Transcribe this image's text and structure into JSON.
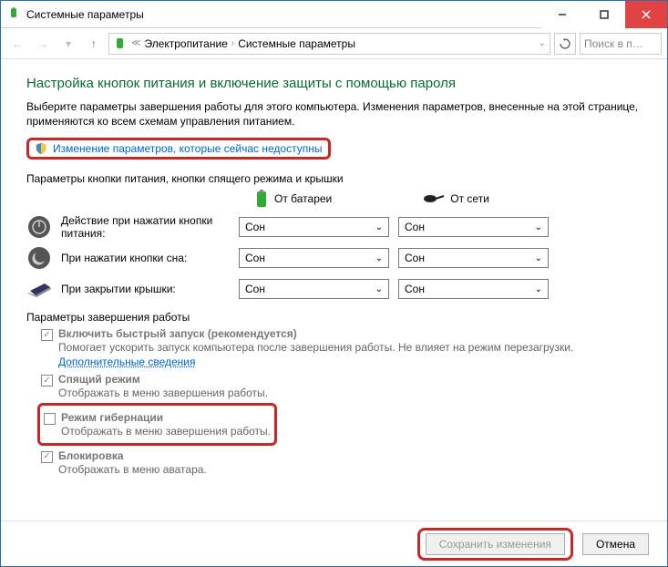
{
  "window": {
    "title": "Системные параметры"
  },
  "breadcrumb": {
    "p1": "Электропитание",
    "p2": "Системные параметры"
  },
  "search": {
    "placeholder": "Поиск в п…"
  },
  "heading": "Настройка кнопок питания и включение защиты с помощью пароля",
  "desc": "Выберите параметры завершения работы для этого компьютера. Изменения параметров, внесенные на этой странице, применяются ко всем схемам управления питанием.",
  "admin_link": "Изменение параметров, которые сейчас недоступны",
  "section1": "Параметры кнопки питания, кнопки спящего режима и крышки",
  "col_battery": "От батареи",
  "col_ac": "От сети",
  "rows": {
    "power": {
      "label": "Действие при нажатии кнопки питания:",
      "b": "Сон",
      "a": "Сон"
    },
    "sleep": {
      "label": "При нажатии кнопки сна:",
      "b": "Сон",
      "a": "Сон"
    },
    "lid": {
      "label": "При закрытии крышки:",
      "b": "Сон",
      "a": "Сон"
    }
  },
  "section2": "Параметры завершения работы",
  "fastboot": {
    "label": "Включить быстрый запуск (рекомендуется)",
    "sub": "Помогает ускорить запуск компьютера после завершения работы. Не влияет на режим перезагрузки. ",
    "link": "Дополнительные сведения"
  },
  "sleepmode": {
    "label": "Спящий режим",
    "sub": "Отображать в меню завершения работы."
  },
  "hibernate": {
    "label": "Режим гибернации",
    "sub": "Отображать в меню завершения работы."
  },
  "lock": {
    "label": "Блокировка",
    "sub": "Отображать в меню аватара."
  },
  "buttons": {
    "save": "Сохранить изменения",
    "cancel": "Отмена"
  }
}
